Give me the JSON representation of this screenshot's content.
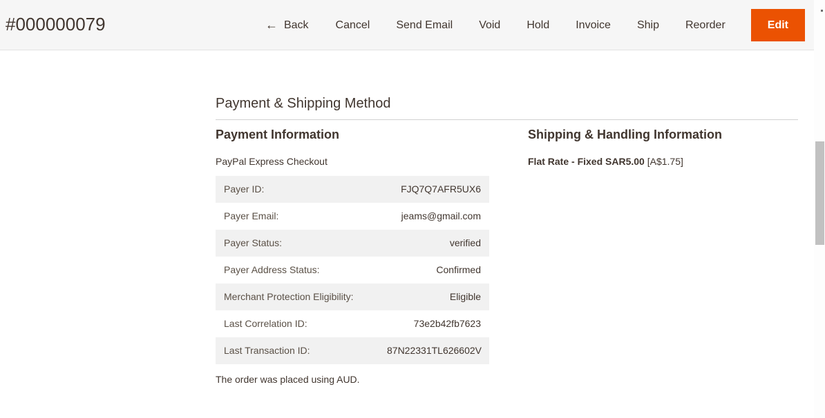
{
  "header": {
    "order_title": "#000000079",
    "actions": [
      {
        "label": "Back",
        "icon": "arrow-left-icon",
        "glyph": "←",
        "style": "link",
        "name": "back-button"
      },
      {
        "label": "Cancel",
        "style": "link",
        "name": "cancel-button"
      },
      {
        "label": "Send Email",
        "style": "link",
        "name": "send-email-button"
      },
      {
        "label": "Void",
        "style": "link",
        "name": "void-button"
      },
      {
        "label": "Hold",
        "style": "link",
        "name": "hold-button"
      },
      {
        "label": "Invoice",
        "style": "link",
        "name": "invoice-button"
      },
      {
        "label": "Ship",
        "style": "link",
        "name": "ship-button"
      },
      {
        "label": "Reorder",
        "style": "link",
        "name": "reorder-button"
      },
      {
        "label": "Edit",
        "style": "primary",
        "name": "edit-button"
      }
    ]
  },
  "main": {
    "section_title": "Payment & Shipping Method",
    "payment": {
      "heading": "Payment Information",
      "method": "PayPal Express Checkout",
      "rows": [
        {
          "label": "Payer ID:",
          "value": "FJQ7Q7AFR5UX6"
        },
        {
          "label": "Payer Email:",
          "value": "jeams@gmail.com"
        },
        {
          "label": "Payer Status:",
          "value": "verified"
        },
        {
          "label": "Payer Address Status:",
          "value": "Confirmed"
        },
        {
          "label": "Merchant Protection Eligibility:",
          "value": "Eligible"
        },
        {
          "label": "Last Correlation ID:",
          "value": "73e2b42fb7623"
        },
        {
          "label": "Last Transaction ID:",
          "value": "87N22331TL626602V"
        }
      ],
      "currency_note": "The order was placed using AUD."
    },
    "shipping": {
      "heading": "Shipping & Handling Information",
      "method": "Flat Rate - Fixed SAR5.00",
      "converted": "[A$1.75]"
    }
  },
  "colors": {
    "accent": "#eb5202",
    "header_bg": "#f6f6f6",
    "text": "#41362f",
    "row_stripe": "#f1f1f1",
    "scrollbar_thumb": "#c1c1c1"
  }
}
